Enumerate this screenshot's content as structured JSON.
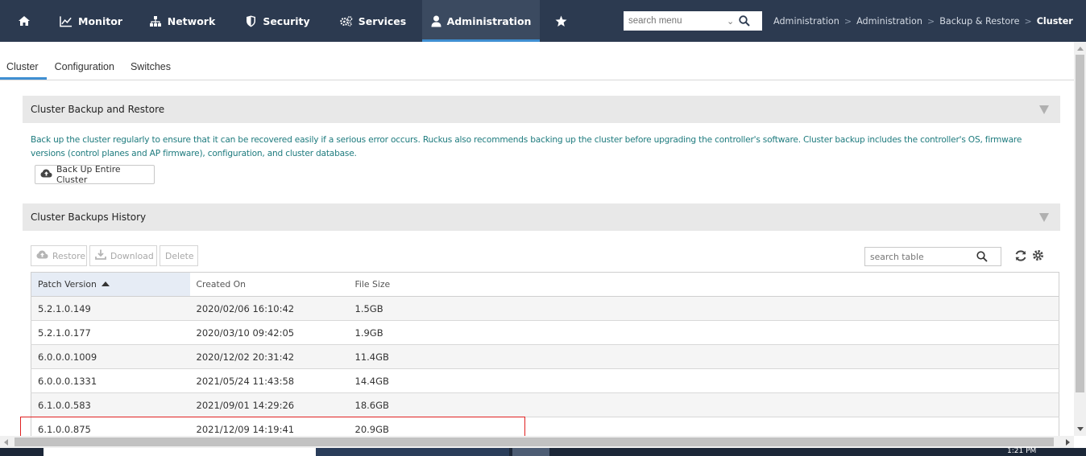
{
  "topnav": {
    "items": [
      {
        "label": "",
        "icon": "home-icon"
      },
      {
        "label": "Monitor",
        "icon": "chart-line-icon"
      },
      {
        "label": "Network",
        "icon": "network-icon"
      },
      {
        "label": "Security",
        "icon": "shield-icon"
      },
      {
        "label": "Services",
        "icon": "gears-icon"
      },
      {
        "label": "Administration",
        "icon": "user-icon"
      },
      {
        "label": "",
        "icon": "star-icon"
      }
    ],
    "active": "Administration",
    "search_placeholder": "search menu",
    "breadcrumb": [
      "Administration",
      "Administration",
      "Backup & Restore",
      "Cluster"
    ],
    "colors": {
      "bar": "#2c3a50",
      "accent": "#3f8fd2"
    }
  },
  "subtabs": [
    "Cluster",
    "Configuration",
    "Switches"
  ],
  "backup_section": {
    "title": "Cluster Backup and Restore",
    "description": "Back up the cluster regularly to ensure that it can be recovered easily if a serious error occurs. Ruckus also recommends backing up the cluster before upgrading the controller's software. Cluster backup includes the controller's OS, firmware versions (control planes and AP firmware), configuration, and cluster database.",
    "button_label": "Back Up Entire Cluster"
  },
  "history_section": {
    "title": "Cluster Backups History",
    "toolbar": {
      "restore": "Restore",
      "download": "Download",
      "delete": "Delete"
    },
    "search_placeholder": "search table",
    "columns": [
      "Patch Version",
      "Created On",
      "File Size"
    ],
    "rows": [
      [
        "5.2.1.0.149",
        "2020/02/06 16:10:42",
        "1.5GB"
      ],
      [
        "5.2.1.0.177",
        "2020/03/10 09:42:05",
        "1.9GB"
      ],
      [
        "6.0.0.0.1009",
        "2020/12/02 20:31:42",
        "11.4GB"
      ],
      [
        "6.0.0.0.1331",
        "2021/05/24 11:43:58",
        "14.4GB"
      ],
      [
        "6.1.0.0.583",
        "2021/09/01 14:29:26",
        "18.6GB"
      ],
      [
        "6.1.0.0.875",
        "2021/12/09 14:19:41",
        "20.9GB"
      ]
    ],
    "highlight_color": "#e02020"
  },
  "taskbar": {
    "clock": "1:21 PM"
  }
}
